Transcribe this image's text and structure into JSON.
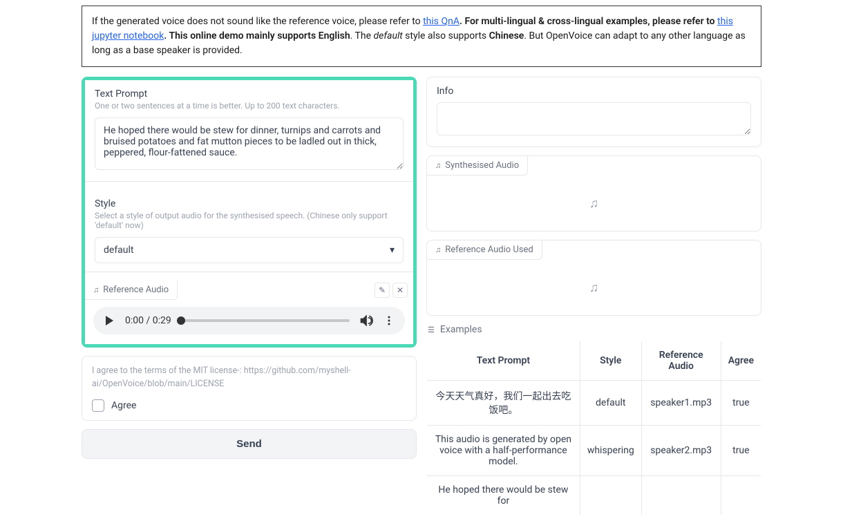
{
  "notice": {
    "prefix": "If the generated voice does not sound like the reference voice, please refer to ",
    "link1": "this QnA",
    "mid1": ". For multi-lingual & cross-lingual examples, please refer to ",
    "link2": "this jupyter notebook",
    "mid2": ". This online demo mainly supports ",
    "english": "English",
    "mid3": ". The ",
    "default_style": "default",
    "mid4": " style also supports ",
    "chinese": "Chinese",
    "tail": ". But OpenVoice can adapt to any other language as long as a base speaker is provided."
  },
  "text_prompt": {
    "label": "Text Prompt",
    "sublabel": "One or two sentences at a time is better. Up to 200 text characters.",
    "value": "He hoped there would be stew for dinner, turnips and carrots and bruised potatoes and fat mutton pieces to be ladled out in thick, peppered, flour-fattened sauce."
  },
  "style": {
    "label": "Style",
    "sublabel": "Select a style of output audio for the synthesised speech. (Chinese only support 'default' now)",
    "value": "default"
  },
  "reference_audio": {
    "label": "Reference Audio",
    "time": "0:00 / 0:29"
  },
  "agree": {
    "text": "I agree to the terms of the MIT license-: https://github.com/myshell-ai/OpenVoice/blob/main/LICENSE",
    "label": "Agree"
  },
  "send_button": "Send",
  "info": {
    "label": "Info"
  },
  "synth_audio": {
    "label": "Synthesised Audio"
  },
  "ref_audio_used": {
    "label": "Reference Audio Used"
  },
  "examples": {
    "label": "Examples",
    "headers": [
      "Text Prompt",
      "Style",
      "Reference Audio",
      "Agree"
    ],
    "rows": [
      {
        "text": "今天天气真好，我们一起出去吃饭吧。",
        "style": "default",
        "ref": "speaker1.mp3",
        "agree": "true"
      },
      {
        "text": "This audio is generated by open voice with a half-performance model.",
        "style": "whispering",
        "ref": "speaker2.mp3",
        "agree": "true"
      },
      {
        "text": "He hoped there would be stew for",
        "style": "",
        "ref": "",
        "agree": ""
      }
    ]
  },
  "icons": {
    "music": "♫",
    "caret_down": "▾",
    "pencil": "✎",
    "close": "✕",
    "list": "☰"
  }
}
